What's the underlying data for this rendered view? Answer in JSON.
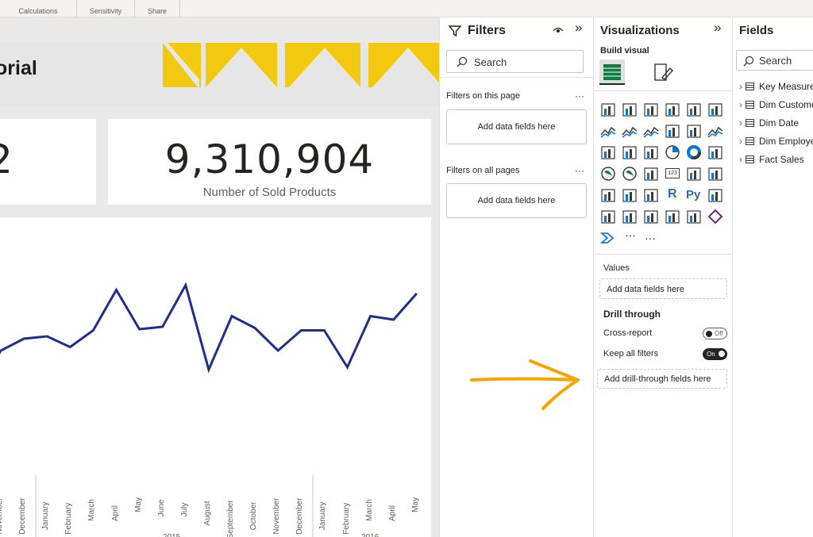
{
  "ribbon": {
    "groups": [
      "Calculations",
      "Sensitivity",
      "Share"
    ]
  },
  "report": {
    "title_fragment": "orial",
    "kpi1": {
      "value": "2"
    },
    "kpi2": {
      "value": "9,310,904",
      "label": "Number of Sold Products"
    },
    "line_color": "#1f2e8c",
    "accent_color": "#f2c811"
  },
  "chart_data": {
    "type": "line",
    "x": [
      "November",
      "December",
      "January",
      "February",
      "March",
      "April",
      "May",
      "June",
      "July",
      "August",
      "September",
      "October",
      "November",
      "December",
      "January",
      "February",
      "March",
      "April",
      "May"
    ],
    "groups": [
      "2015",
      "2016"
    ],
    "values": [
      null,
      68,
      64,
      55,
      64,
      44,
      11,
      44,
      42,
      7,
      78,
      33,
      37,
      56,
      56,
      80,
      40,
      40,
      47,
      14
    ],
    "series_values": [
      62,
      52,
      50,
      59,
      45,
      11,
      44,
      42,
      7,
      78,
      33,
      43,
      62,
      45,
      45,
      76,
      33,
      36,
      14
    ]
  },
  "filters": {
    "title": "Filters",
    "search_placeholder": "Search",
    "on_this_page": "Filters on this page",
    "on_all_pages": "Filters on all pages",
    "add_fields": "Add data fields here",
    "more": "···"
  },
  "visualizations": {
    "title": "Visualizations",
    "build_visual": "Build visual",
    "more": "···",
    "values_label": "Values",
    "values_well": "Add data fields here",
    "drill_through": "Drill through",
    "cross_report": "Cross-report",
    "cross_report_state": "Off",
    "keep_filters": "Keep all filters",
    "keep_filters_state": "On",
    "drill_well": "Add drill-through fields here",
    "r_label": "R",
    "py_label": "Py",
    "num_label": "123"
  },
  "fields": {
    "title": "Fields",
    "search_placeholder": "Search",
    "items": [
      "Key Measures",
      "Dim Customer",
      "Dim Date",
      "Dim Employee",
      "Fact Sales"
    ]
  },
  "annotation": {
    "arrow_color": "#f5a400"
  }
}
